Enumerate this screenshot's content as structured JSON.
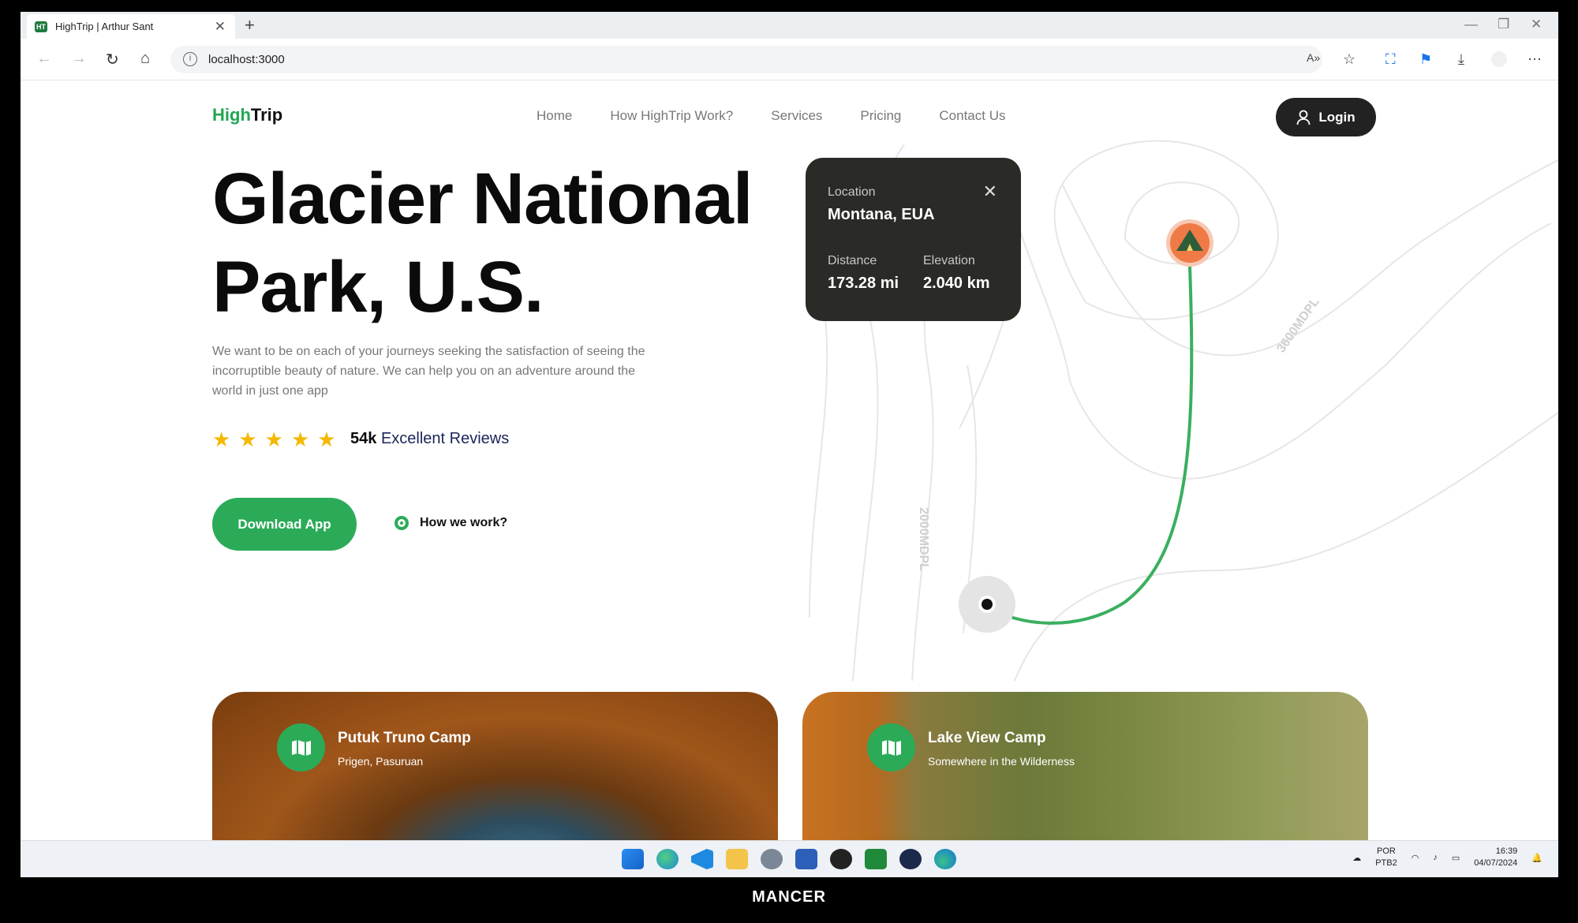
{
  "browser": {
    "tab_title": "HighTrip | Arthur Sant",
    "url": "localhost:3000",
    "favicon_text": "HT"
  },
  "nav": {
    "logo_high": "High",
    "logo_trip": "Trip",
    "links": [
      "Home",
      "How HighTrip Work?",
      "Services",
      "Pricing",
      "Contact Us"
    ],
    "login_label": "Login"
  },
  "hero": {
    "title_line1": "Glacier National",
    "title_line2": "Park, U.S.",
    "description": "We want to be on each of your journeys seeking the satisfaction of seeing the incorruptible beauty of nature. We can help you on an adventure around the world in just one app",
    "rating_stars": 5,
    "reviews_count": "54k",
    "reviews_label": "Excellent Reviews",
    "download_label": "Download App",
    "how_label": "How we work?"
  },
  "map_popup": {
    "location_label": "Location",
    "location_value": "Montana, EUA",
    "distance_label": "Distance",
    "distance_value": "173.28 mi",
    "elevation_label": "Elevation",
    "elevation_value": "2.040 km"
  },
  "map_labels": {
    "contour_a": "3600MDPL",
    "contour_b": "2000MDPL"
  },
  "cards": [
    {
      "title": "Putuk Truno Camp",
      "subtitle": "Prigen, Pasuruan"
    },
    {
      "title": "Lake View Camp",
      "subtitle": "Somewhere in the Wilderness"
    }
  ],
  "taskbar": {
    "lang1": "POR",
    "lang2": "PTB2",
    "time": "16:39",
    "date": "04/07/2024"
  },
  "footer_brand": "MANCER",
  "colors": {
    "accent": "#2bab58",
    "dark": "#222222",
    "star": "#f5b800",
    "pin": "#f07a45"
  }
}
